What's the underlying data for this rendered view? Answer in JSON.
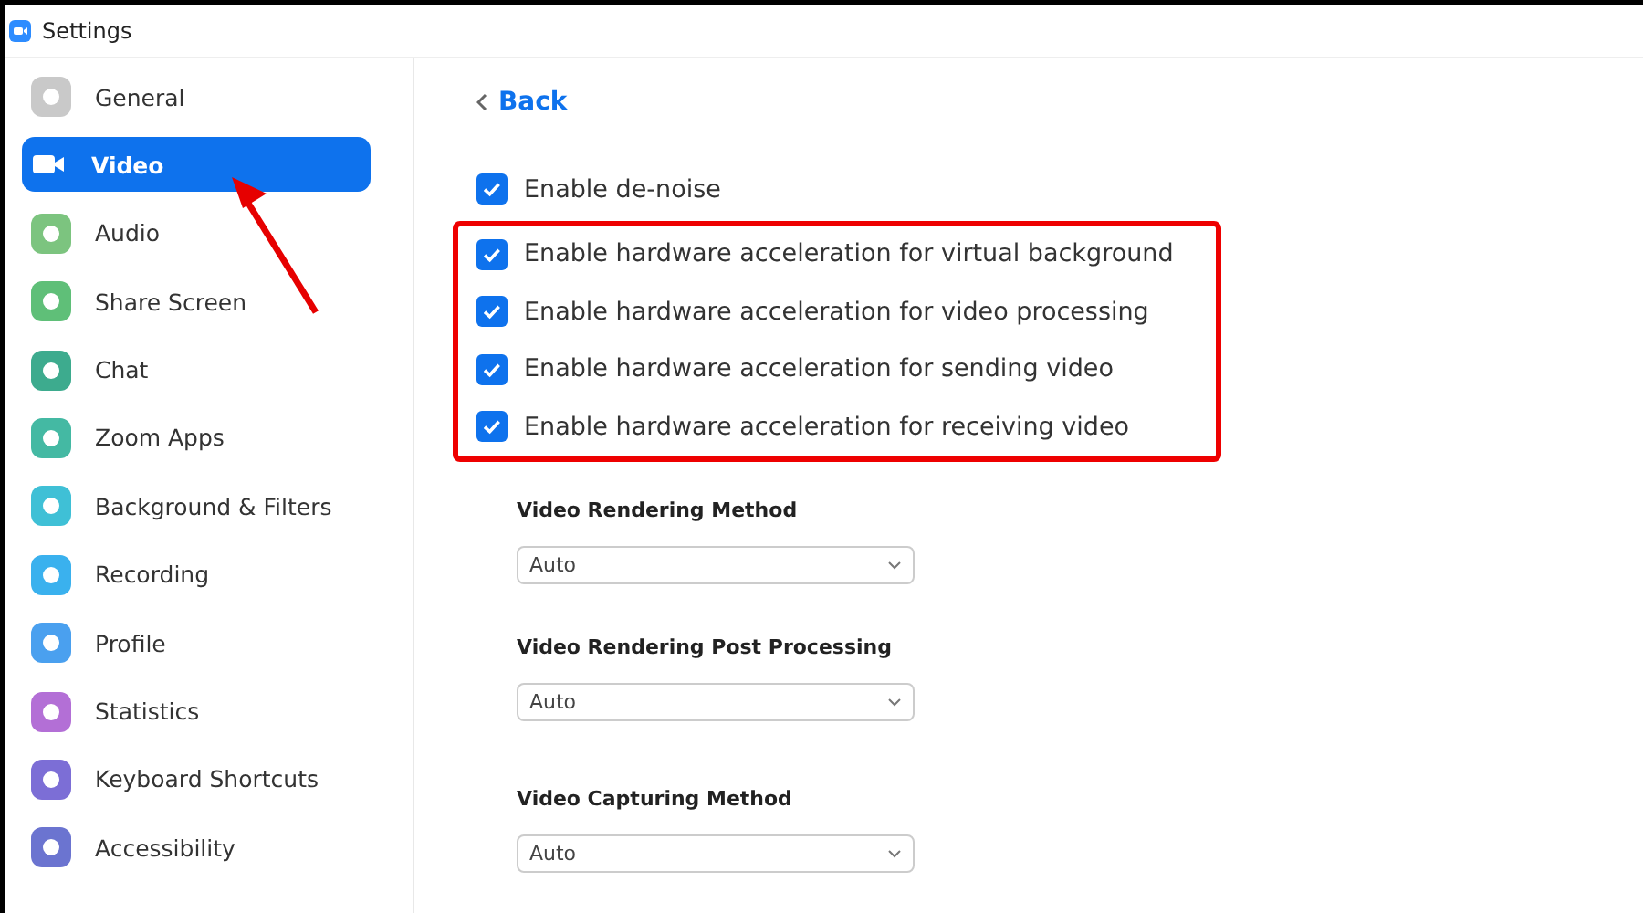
{
  "window": {
    "title": "Settings"
  },
  "sidebar": {
    "items": [
      {
        "label": "General",
        "selected": false,
        "color": "#c9c9c9"
      },
      {
        "label": "Video",
        "selected": true,
        "color": "#0e72ed"
      },
      {
        "label": "Audio",
        "selected": false,
        "color": "#7cc47f"
      },
      {
        "label": "Share Screen",
        "selected": false,
        "color": "#5fbf78"
      },
      {
        "label": "Chat",
        "selected": false,
        "color": "#3dab8e"
      },
      {
        "label": "Zoom Apps",
        "selected": false,
        "color": "#44b9a3"
      },
      {
        "label": "Background & Filters",
        "selected": false,
        "color": "#3fc0d6"
      },
      {
        "label": "Recording",
        "selected": false,
        "color": "#3ab1ee"
      },
      {
        "label": "Profile",
        "selected": false,
        "color": "#4aa0ef"
      },
      {
        "label": "Statistics",
        "selected": false,
        "color": "#b36fd6"
      },
      {
        "label": "Keyboard Shortcuts",
        "selected": false,
        "color": "#7c6ed6"
      },
      {
        "label": "Accessibility",
        "selected": false,
        "color": "#6b74d0"
      }
    ]
  },
  "back": {
    "label": "Back"
  },
  "options": [
    {
      "label": "Enable de-noise",
      "checked": true,
      "highlighted": false
    },
    {
      "label": "Enable hardware acceleration for virtual background",
      "checked": true,
      "highlighted": true
    },
    {
      "label": "Enable hardware acceleration for video processing",
      "checked": true,
      "highlighted": true
    },
    {
      "label": "Enable hardware acceleration for sending video",
      "checked": true,
      "highlighted": true
    },
    {
      "label": "Enable hardware acceleration for receiving video",
      "checked": true,
      "highlighted": true
    }
  ],
  "dropdowns": [
    {
      "label": "Video Rendering Method",
      "value": "Auto"
    },
    {
      "label": "Video Rendering Post Processing",
      "value": "Auto"
    },
    {
      "label": "Video Capturing Method",
      "value": "Auto"
    }
  ],
  "annotation": {
    "arrow": true
  }
}
